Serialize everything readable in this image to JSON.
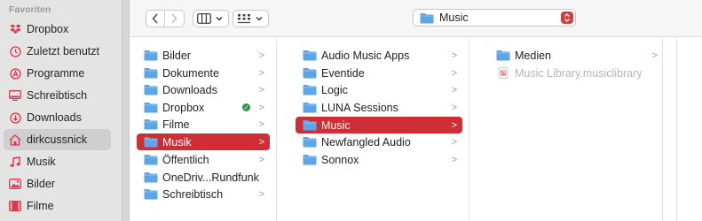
{
  "sidebar": {
    "section_title": "Favoriten",
    "items": [
      {
        "label": "Dropbox",
        "icon": "dropbox-icon"
      },
      {
        "label": "Zuletzt benutzt",
        "icon": "clock-icon"
      },
      {
        "label": "Programme",
        "icon": "apps-icon"
      },
      {
        "label": "Schreibtisch",
        "icon": "desktop-icon"
      },
      {
        "label": "Downloads",
        "icon": "download-icon"
      },
      {
        "label": "dirkcussnick",
        "icon": "home-icon",
        "selected": true
      },
      {
        "label": "Musik",
        "icon": "music-note-icon"
      },
      {
        "label": "Bilder",
        "icon": "photo-icon"
      },
      {
        "label": "Filme",
        "icon": "film-icon"
      }
    ]
  },
  "toolbar": {
    "back": "<",
    "forward": ">",
    "path_title": "Music"
  },
  "columns": [
    {
      "items": [
        {
          "label": "Bilder"
        },
        {
          "label": "Dokumente"
        },
        {
          "label": "Downloads"
        },
        {
          "label": "Dropbox",
          "synced": true
        },
        {
          "label": "Filme"
        },
        {
          "label": "Musik",
          "selected": true
        },
        {
          "label": "Öffentlich"
        },
        {
          "label": "OneDriv...Rundfunk"
        },
        {
          "label": "Schreibtisch"
        }
      ]
    },
    {
      "items": [
        {
          "label": "Audio Music Apps"
        },
        {
          "label": "Eventide"
        },
        {
          "label": "Logic"
        },
        {
          "label": "LUNA Sessions"
        },
        {
          "label": "Music",
          "selected": true
        },
        {
          "label": "Newfangled Audio"
        },
        {
          "label": "Sonnox"
        }
      ]
    },
    {
      "items": [
        {
          "label": "Medien"
        },
        {
          "label": "Music Library.musiclibrary",
          "file": true
        }
      ]
    }
  ],
  "colors": {
    "accent": "#cf2f34",
    "sidebar_icon": "#e0344a",
    "folder": "#5aa6e6"
  }
}
